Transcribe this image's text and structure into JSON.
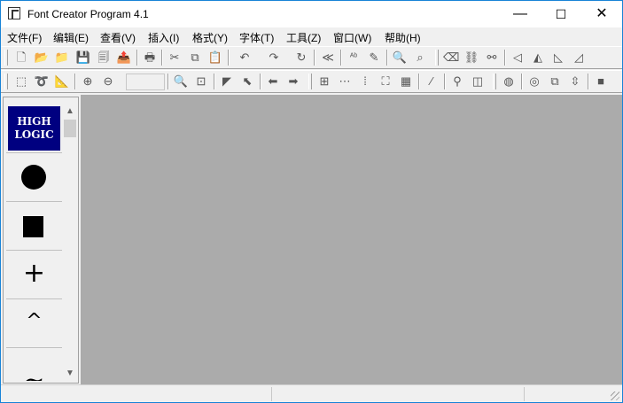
{
  "window": {
    "title": "Font Creator Program 4.1",
    "minimize": "—",
    "maximize": "☐",
    "close": "✕"
  },
  "menu": [
    "文件(F)",
    "编辑(E)",
    "查看(V)",
    "插入(I)",
    "格式(Y)",
    "字体(T)",
    "工具(Z)",
    "窗口(W)",
    "帮助(H)"
  ],
  "toolbar1": [
    {
      "icon": "new-file-icon",
      "glyph": "🗋"
    },
    {
      "icon": "open-wizard-icon",
      "glyph": "📂"
    },
    {
      "icon": "open-folder-icon",
      "glyph": "📁"
    },
    {
      "icon": "save-icon",
      "glyph": "💾"
    },
    {
      "icon": "save-all-icon",
      "glyph": "🗐"
    },
    {
      "icon": "export-icon",
      "glyph": "📤"
    },
    {
      "icon": "print-icon",
      "glyph": "🖶"
    },
    {
      "icon": "cut-icon",
      "glyph": "✂"
    },
    {
      "icon": "copy-icon",
      "glyph": "⧉"
    },
    {
      "icon": "paste-icon",
      "glyph": "📋"
    },
    {
      "icon": "undo-icon",
      "glyph": "↶"
    },
    {
      "icon": "redo-icon",
      "glyph": "↷"
    },
    {
      "icon": "refresh-icon",
      "glyph": "↻"
    },
    {
      "icon": "abc-icon",
      "glyph": "≪"
    },
    {
      "icon": "spell-icon",
      "glyph": "ᴬᵇ"
    },
    {
      "icon": "pen-icon",
      "glyph": "✎"
    },
    {
      "icon": "preview-icon",
      "glyph": "🔍"
    },
    {
      "icon": "find-icon",
      "glyph": "⌕"
    },
    {
      "icon": "eraser-icon",
      "glyph": "⌫"
    },
    {
      "icon": "link-icon",
      "glyph": "⛓"
    },
    {
      "icon": "unlink-icon",
      "glyph": "⚯"
    },
    {
      "icon": "flip-left-icon",
      "glyph": "◁"
    },
    {
      "icon": "flip-horizontal-icon",
      "glyph": "◭"
    },
    {
      "icon": "rotate-left-icon",
      "glyph": "◺"
    },
    {
      "icon": "rotate-right-icon",
      "glyph": "◿"
    }
  ],
  "toolbar2": [
    {
      "icon": "rect-select-icon",
      "glyph": "⬚"
    },
    {
      "icon": "lasso-icon",
      "glyph": "➰"
    },
    {
      "icon": "measure-icon",
      "glyph": "📐"
    },
    {
      "icon": "zoom-in-icon",
      "glyph": "⊕"
    },
    {
      "icon": "zoom-out-icon",
      "glyph": "⊖"
    },
    {
      "icon": "magnifier-icon",
      "glyph": "🔍"
    },
    {
      "icon": "fit-icon",
      "glyph": "⊡"
    },
    {
      "icon": "pointer-icon",
      "glyph": "◤"
    },
    {
      "icon": "node-pointer-icon",
      "glyph": "⬉"
    },
    {
      "icon": "arrow-left-icon",
      "glyph": "⬅"
    },
    {
      "icon": "arrow-right-icon",
      "glyph": "➡"
    },
    {
      "icon": "grid-icon",
      "glyph": "⊞"
    },
    {
      "icon": "grid-points-icon",
      "glyph": "⋯"
    },
    {
      "icon": "grid-dotted-icon",
      "glyph": "⁞"
    },
    {
      "icon": "grid-corners-icon",
      "glyph": "⛶"
    },
    {
      "icon": "grid-lines-icon",
      "glyph": "▦"
    },
    {
      "icon": "percent-icon",
      "glyph": "⁄"
    },
    {
      "icon": "nodes-icon",
      "glyph": "⚲"
    },
    {
      "icon": "frame-icon",
      "glyph": "◫"
    },
    {
      "icon": "globe-icon",
      "glyph": "◍"
    },
    {
      "icon": "circles-icon",
      "glyph": "◎"
    },
    {
      "icon": "overlap-icon",
      "glyph": "⧉"
    },
    {
      "icon": "move-icon",
      "glyph": "⇳"
    },
    {
      "icon": "stop-icon",
      "glyph": "■"
    }
  ],
  "glyph_panel": {
    "logo_line1": "HIGH",
    "logo_line2": "LOGIC",
    "items": [
      "+",
      "^",
      "~"
    ],
    "scroll_up": "▲",
    "scroll_down": "▼"
  }
}
